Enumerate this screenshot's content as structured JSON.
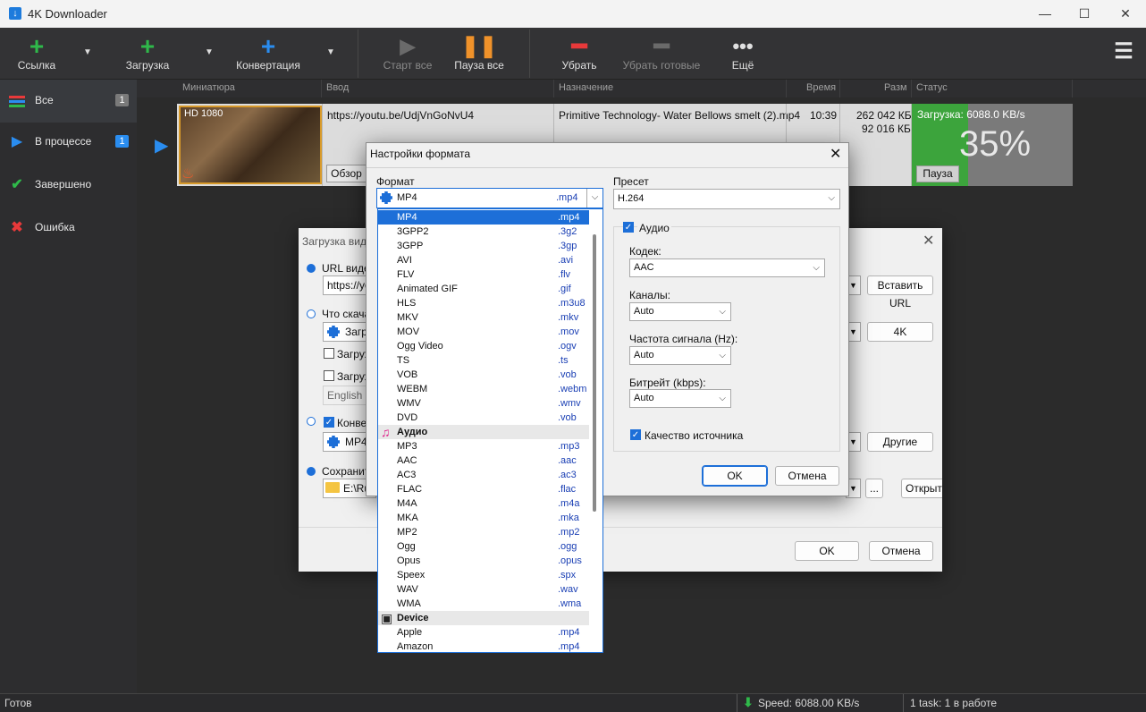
{
  "window": {
    "title": "4K Downloader",
    "icon": "download-app-icon"
  },
  "toolbar": {
    "link": "Ссылка",
    "download": "Загрузка",
    "convert": "Конвертация",
    "start_all": "Старт все",
    "pause_all": "Пауза все",
    "remove": "Убрать",
    "remove_done": "Убрать готовые",
    "more": "Ещё"
  },
  "sidebar": {
    "items": [
      {
        "label": "Все",
        "count": "1",
        "icon": "list-icon"
      },
      {
        "label": "В процессе",
        "count": "1",
        "icon": "play-icon"
      },
      {
        "label": "Завершено",
        "icon": "check-icon"
      },
      {
        "label": "Ошибка",
        "icon": "x-icon"
      }
    ]
  },
  "columns": [
    "Миниатюра",
    "Ввод",
    "Назначение",
    "Время",
    "Разм",
    "Статус"
  ],
  "row": {
    "quality": "HD 1080",
    "url": "https://youtu.be/UdjVnGoNvU4",
    "browse": "Обзор",
    "dest": "Primitive Technology- Water Bellows smelt (2).mp4",
    "time": "10:39",
    "size1": "262 042 КБ",
    "size2": "92 016 КБ",
    "status": "Загрузка: 6088.0 KB/s",
    "percent": "35%",
    "progress": 0.35,
    "pause": "Пауза"
  },
  "statusbar": {
    "ready": "Готов",
    "speed": "Speed: 6088.00 KB/s",
    "tasks": "1 task: 1 в работе"
  },
  "bg_dialog": {
    "title": "Загрузка вид",
    "url_label": "URL видео",
    "url_value": "https://you",
    "paste_url": "Вставить URL",
    "what_label": "Что скача",
    "what_value": "Загр",
    "quality": "4K",
    "cb1": "Загруж",
    "cb2": "Загруж",
    "lang": "English",
    "convert_label": "Конвер",
    "convert_value": "MP4",
    "other": "Другие",
    "save_label": "Сохранит",
    "save_value": "E:\\Ru",
    "dots": "...",
    "open": "Открыт",
    "ok": "OK",
    "cancel": "Отмена"
  },
  "format_dialog": {
    "title": "Настройки формата",
    "format_label": "Формат",
    "format_value": "MP4",
    "format_ext": ".mp4",
    "preset_label": "Пресет",
    "preset_value": "H.264",
    "audio_label": "Аудио",
    "codec_label": "Кодек:",
    "codec_value": "AAC",
    "channels_label": "Каналы:",
    "channels_value": "Auto",
    "freq_label": "Частота сигнала (Hz):",
    "freq_value": "Auto",
    "bitrate_label": "Битрейт (kbps):",
    "bitrate_value": "Auto",
    "source_quality": "Качество источника",
    "ok": "OK",
    "cancel": "Отмена"
  },
  "format_list": [
    {
      "name": "MP4",
      "ext": ".mp4",
      "selected": true
    },
    {
      "name": "3GPP2",
      "ext": ".3g2"
    },
    {
      "name": "3GPP",
      "ext": ".3gp"
    },
    {
      "name": "AVI",
      "ext": ".avi"
    },
    {
      "name": "FLV",
      "ext": ".flv"
    },
    {
      "name": "Animated GIF",
      "ext": ".gif"
    },
    {
      "name": "HLS",
      "ext": ".m3u8"
    },
    {
      "name": "MKV",
      "ext": ".mkv"
    },
    {
      "name": "MOV",
      "ext": ".mov"
    },
    {
      "name": "Ogg Video",
      "ext": ".ogv"
    },
    {
      "name": "TS",
      "ext": ".ts"
    },
    {
      "name": "VOB",
      "ext": ".vob"
    },
    {
      "name": "WEBM",
      "ext": ".webm"
    },
    {
      "name": "WMV",
      "ext": ".wmv"
    },
    {
      "name": "DVD",
      "ext": ".vob"
    },
    {
      "name": "Аудио",
      "group": true,
      "icon": "music-note-icon"
    },
    {
      "name": "MP3",
      "ext": ".mp3"
    },
    {
      "name": "AAC",
      "ext": ".aac"
    },
    {
      "name": "AC3",
      "ext": ".ac3"
    },
    {
      "name": "FLAC",
      "ext": ".flac"
    },
    {
      "name": "M4A",
      "ext": ".m4a"
    },
    {
      "name": "MKA",
      "ext": ".mka"
    },
    {
      "name": "MP2",
      "ext": ".mp2"
    },
    {
      "name": "Ogg",
      "ext": ".ogg"
    },
    {
      "name": "Opus",
      "ext": ".opus"
    },
    {
      "name": "Speex",
      "ext": ".spx"
    },
    {
      "name": "WAV",
      "ext": ".wav"
    },
    {
      "name": "WMA",
      "ext": ".wma"
    },
    {
      "name": "Device",
      "group": true,
      "icon": "device-icon"
    },
    {
      "name": "Apple",
      "ext": ".mp4"
    },
    {
      "name": "Amazon",
      "ext": ".mp4"
    }
  ]
}
